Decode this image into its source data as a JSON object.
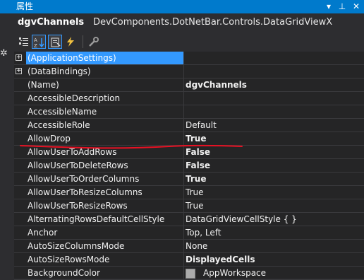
{
  "window": {
    "title": "属性",
    "dropdown_icon": "dropdown-arrow-icon",
    "pin_icon": "pin-icon",
    "close_icon": "close-icon"
  },
  "object": {
    "name": "dgvChannels",
    "type": "DevComponents.DotNetBar.Controls.DataGridViewX"
  },
  "toolbar": {
    "items": [
      {
        "icon": "categorized-icon",
        "active": false
      },
      {
        "icon": "alphabetical-icon",
        "active": true
      },
      {
        "icon": "properties-icon",
        "active": true
      },
      {
        "icon": "events-lightning-icon",
        "active": false
      },
      {
        "icon": "property-pages-wrench-icon",
        "active": false
      }
    ]
  },
  "properties": [
    {
      "name": "(ApplicationSettings)",
      "value": "",
      "expandable": true,
      "selected": true
    },
    {
      "name": "(DataBindings)",
      "value": "",
      "expandable": true
    },
    {
      "name": "(Name)",
      "value": "dgvChannels",
      "bold": true
    },
    {
      "name": "AccessibleDescription",
      "value": ""
    },
    {
      "name": "AccessibleName",
      "value": ""
    },
    {
      "name": "AccessibleRole",
      "value": "Default"
    },
    {
      "name": "AllowDrop",
      "value": "True",
      "bold": true
    },
    {
      "name": "AllowUserToAddRows",
      "value": "False",
      "bold": true
    },
    {
      "name": "AllowUserToDeleteRows",
      "value": "False",
      "bold": true
    },
    {
      "name": "AllowUserToOrderColumns",
      "value": "True",
      "bold": true
    },
    {
      "name": "AllowUserToResizeColumns",
      "value": "True"
    },
    {
      "name": "AllowUserToResizeRows",
      "value": "True"
    },
    {
      "name": "AlternatingRowsDefaultCellStyle",
      "value": "DataGridViewCellStyle { }"
    },
    {
      "name": "Anchor",
      "value": "Top, Left"
    },
    {
      "name": "AutoSizeColumnsMode",
      "value": "None"
    },
    {
      "name": "AutoSizeRowsMode",
      "value": "DisplayedCells",
      "bold": true
    },
    {
      "name": "BackgroundColor",
      "value": "AppWorkspace",
      "swatch": "#ababab"
    }
  ],
  "colors": {
    "accent": "#007acc",
    "selection": "#3399ff",
    "annotation": "#e81123"
  }
}
